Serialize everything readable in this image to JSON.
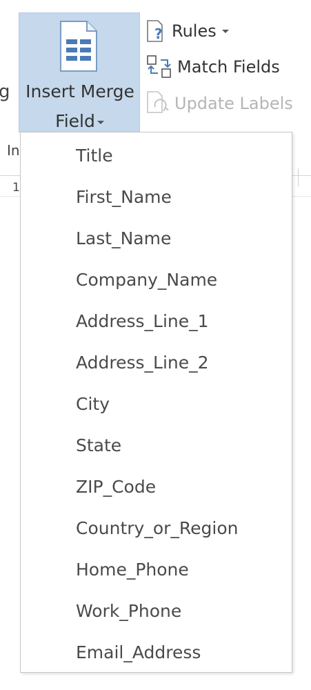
{
  "ribbon": {
    "cut_label": "g",
    "insert_merge_field": {
      "line1": "Insert Merge",
      "line2": "Field"
    },
    "rules_label": "Rules",
    "match_fields_label": "Match Fields",
    "update_labels_label": "Update Labels"
  },
  "document": {
    "header_fragment": "In",
    "cell_fragment": "1"
  },
  "merge_fields_menu": {
    "items": [
      "Title",
      "First_Name",
      "Last_Name",
      "Company_Name",
      "Address_Line_1",
      "Address_Line_2",
      "City",
      "State",
      "ZIP_Code",
      "Country_or_Region",
      "Home_Phone",
      "Work_Phone",
      "Email_Address"
    ]
  },
  "colors": {
    "selected_button_bg": "#c5d8ec",
    "disabled_text": "#b5b5b5",
    "icon_blue": "#4a7bb5"
  }
}
